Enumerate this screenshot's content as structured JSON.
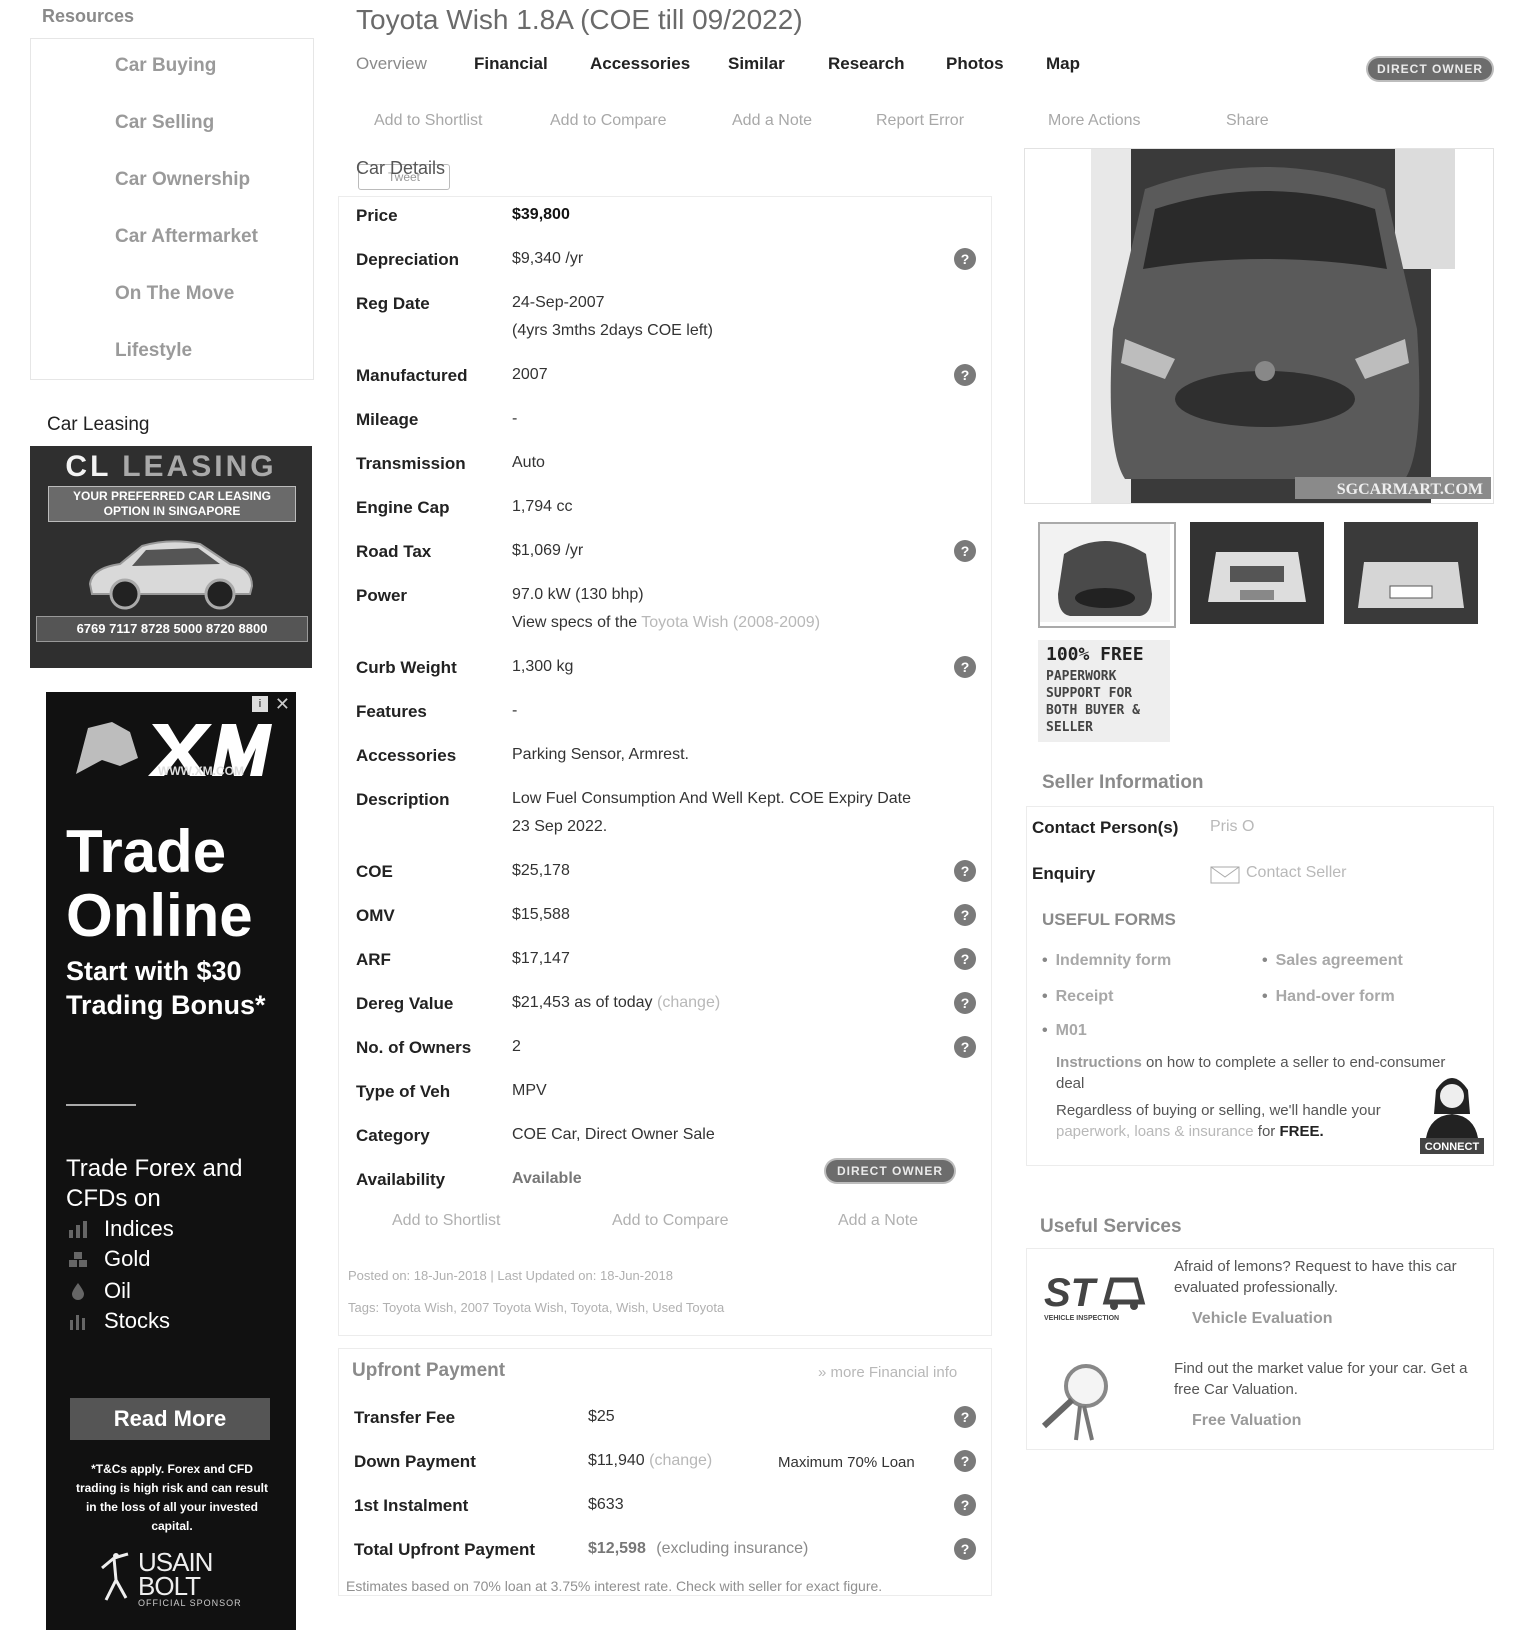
{
  "sidebar": {
    "resources_title": "Resources",
    "items": [
      "Car Buying",
      "Car Selling",
      "Car Ownership",
      "Car Aftermarket",
      "On The Move",
      "Lifestyle"
    ],
    "leasing_title": "Car Leasing",
    "leasing_ad": {
      "brand_cl": "CL",
      "brand_leasing": "LEASING",
      "tagline": "YOUR PREFERRED CAR LEASING OPTION IN SINGAPORE",
      "phones": "6769 7117  8728 5000  8720 8800"
    },
    "xm_ad": {
      "close": "✕",
      "adchoice": "i",
      "url": "WWW.XM.COM",
      "headline": "Trade Online",
      "sub": "Start with $30 Trading Bonus*",
      "forex": "Trade Forex and CFDs on",
      "markets": [
        "Indices",
        "Gold",
        "Oil",
        "Stocks"
      ],
      "read_more": "Read More",
      "disclaimer": "*T&Cs apply. Forex and CFD trading is high risk and can result in the loss of all your invested capital.",
      "bolt_name": "USAIN BOLT",
      "bolt_sub": "OFFICIAL SPONSOR"
    }
  },
  "header": {
    "title": "Toyota Wish 1.8A (COE till 09/2022)",
    "tabs": [
      "Overview",
      "Financial",
      "Accessories",
      "Similar",
      "Research",
      "Photos",
      "Map"
    ],
    "badge": "DIRECT OWNER",
    "actions": [
      "Add to Shortlist",
      "Add to Compare",
      "Add a Note",
      "Report Error",
      "More Actions",
      "Share"
    ]
  },
  "details": {
    "title": "Car Details",
    "tweet": "Tweet",
    "rows": {
      "price": {
        "label": "Price",
        "value": "$39,800"
      },
      "depreciation": {
        "label": "Depreciation",
        "value": "$9,340 /yr"
      },
      "reg_date": {
        "label": "Reg Date",
        "value": "24-Sep-2007",
        "value2": "(4yrs 3mths 2days COE left)"
      },
      "manufactured": {
        "label": "Manufactured",
        "value": "2007"
      },
      "mileage": {
        "label": "Mileage",
        "value": "-"
      },
      "transmission": {
        "label": "Transmission",
        "value": "Auto"
      },
      "engine_cap": {
        "label": "Engine Cap",
        "value": "1,794 cc"
      },
      "road_tax": {
        "label": "Road Tax",
        "value": "$1,069 /yr"
      },
      "power": {
        "label": "Power",
        "value": "97.0 kW (130 bhp)",
        "value2_prefix": "View specs of the",
        "value2_link": "Toyota Wish (2008-2009)"
      },
      "curb_weight": {
        "label": "Curb Weight",
        "value": "1,300 kg"
      },
      "features": {
        "label": "Features",
        "value": "-"
      },
      "accessories": {
        "label": "Accessories",
        "value": "Parking Sensor, Armrest."
      },
      "description": {
        "label": "Description",
        "value": "Low Fuel Consumption And Well Kept. COE Expiry Date",
        "value2": "23 Sep 2022."
      },
      "coe": {
        "label": "COE",
        "value": "$25,178"
      },
      "omv": {
        "label": "OMV",
        "value": "$15,588"
      },
      "arf": {
        "label": "ARF",
        "value": "$17,147"
      },
      "dereg": {
        "label": "Dereg Value",
        "value": "$21,453 as of today",
        "change": "(change)"
      },
      "owners": {
        "label": "No. of Owners",
        "value": "2"
      },
      "type": {
        "label": "Type of Veh",
        "value": "MPV"
      },
      "category": {
        "label": "Category",
        "value": "COE Car, Direct Owner Sale"
      },
      "availability": {
        "label": "Availability",
        "value": "Available"
      }
    },
    "help_glyph": "?",
    "availability_badge": "DIRECT OWNER",
    "bottom_actions": [
      "Add to Shortlist",
      "Add to Compare",
      "Add a Note"
    ],
    "posted": "Posted on: 18-Jun-2018  |  Last Updated on: 18-Jun-2018",
    "tags": "Tags: Toyota Wish, 2007 Toyota Wish, Toyota, Wish, Used Toyota"
  },
  "upfront": {
    "title": "Upfront Payment",
    "more": "» more Financial info",
    "transfer_fee": {
      "label": "Transfer Fee",
      "value": "$25"
    },
    "down_payment": {
      "label": "Down Payment",
      "value": "$11,940",
      "change": "(change)",
      "note": "Maximum 70% Loan"
    },
    "instalment": {
      "label": "1st Instalment",
      "value": "$633"
    },
    "total": {
      "label": "Total Upfront Payment",
      "value": "$12,598",
      "note": "(excluding insurance)"
    },
    "footnote": "Estimates based on 70% loan at 3.75% interest rate. Check with seller for exact figure."
  },
  "right": {
    "watermark": "SGCARMART.COM",
    "free_badge": {
      "big": "100% FREE",
      "small": "PAPERWORK SUPPORT FOR BOTH BUYER & SELLER"
    },
    "seller": {
      "title": "Seller Information",
      "contact_label": "Contact Person(s)",
      "contact_value": "Pris O",
      "enquiry_label": "Enquiry",
      "enquiry_value": "Contact Seller",
      "forms_title": "USEFUL FORMS",
      "forms": [
        "Indemnity form",
        "Sales agreement",
        "Receipt",
        "Hand-over form",
        "M01"
      ],
      "instructions_link": "Instructions",
      "instructions_rest": "on how to complete a seller to end-consumer deal",
      "regardless_prefix": "Regardless of buying or selling, we'll handle your",
      "regardless_link": "paperwork, loans & insurance",
      "regardless_for": "for",
      "regardless_free": "FREE.",
      "agent_caption": "CONNECT"
    },
    "services": {
      "title": "Useful Services",
      "sta_caption": "VEHICLE INSPECTION",
      "eval_text": "Afraid of lemons? Request to have this car evaluated professionally.",
      "eval_link": "Vehicle Evaluation",
      "valuation_text": "Find out the market value for your car. Get a free Car Valuation.",
      "valuation_link": "Free Valuation"
    }
  }
}
